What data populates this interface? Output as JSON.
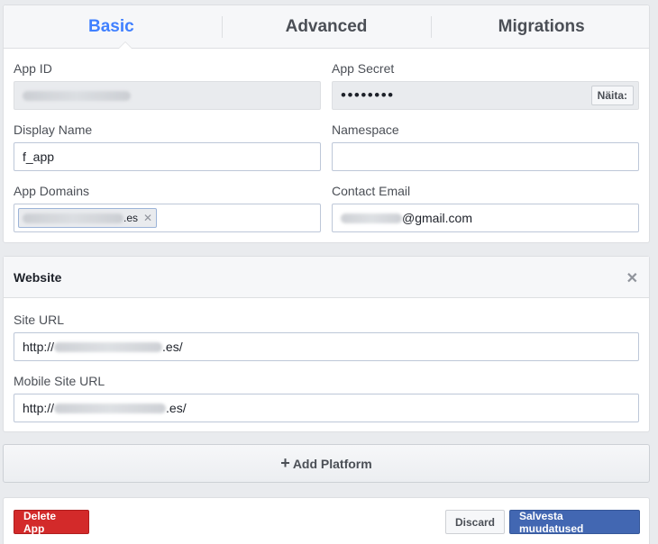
{
  "tabs": [
    {
      "label": "Basic",
      "active": true
    },
    {
      "label": "Advanced",
      "active": false
    },
    {
      "label": "Migrations",
      "active": false
    }
  ],
  "basic": {
    "app_id_label": "App ID",
    "app_id_value": "",
    "app_secret_label": "App Secret",
    "app_secret_value": "••••••••",
    "show_button": "Näita:",
    "display_name_label": "Display Name",
    "display_name_value": "f_app",
    "namespace_label": "Namespace",
    "namespace_value": "",
    "app_domains_label": "App Domains",
    "app_domain_token_suffix": ".es",
    "contact_email_label": "Contact Email",
    "contact_email_suffix": "@gmail.com"
  },
  "website": {
    "title": "Website",
    "site_url_label": "Site URL",
    "site_url_prefix": "http://",
    "site_url_suffix": ".es/",
    "mobile_site_url_label": "Mobile Site URL",
    "mobile_site_url_prefix": "http://",
    "mobile_site_url_suffix": ".es/"
  },
  "add_platform": {
    "label": "Add Platform"
  },
  "footer": {
    "delete_label": "Delete App",
    "discard_label": "Discard",
    "save_label": "Salvesta muudatused"
  },
  "colors": {
    "accent": "#4080ff",
    "delete": "#d32a2a",
    "primary": "#4267b2"
  },
  "icons": {
    "token_remove": "close-icon",
    "panel_close": "close-icon",
    "add": "plus-icon"
  }
}
